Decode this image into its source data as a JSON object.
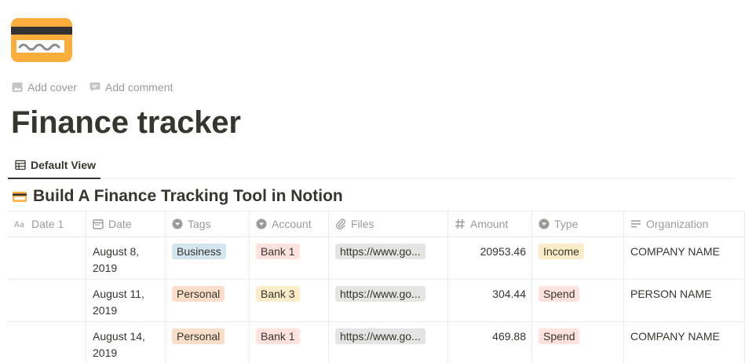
{
  "page": {
    "icon": "credit-card-icon",
    "actions": {
      "add_cover": "Add cover",
      "add_comment": "Add comment"
    },
    "title": "Finance tracker"
  },
  "views": [
    {
      "label": "Default View",
      "icon": "table-icon",
      "active": true
    }
  ],
  "database": {
    "icon": "credit-card-icon",
    "title": "Build A Finance Tracking Tool in Notion",
    "columns": [
      {
        "label": "Date 1",
        "icon": "title-aa-icon"
      },
      {
        "label": "Date",
        "icon": "calendar-icon"
      },
      {
        "label": "Tags",
        "icon": "select-icon"
      },
      {
        "label": "Account",
        "icon": "select-icon"
      },
      {
        "label": "Files",
        "icon": "paperclip-icon"
      },
      {
        "label": "Amount",
        "icon": "number-hash-icon"
      },
      {
        "label": "Type",
        "icon": "select-icon"
      },
      {
        "label": "Organization",
        "icon": "text-lines-icon"
      }
    ],
    "rows": [
      {
        "date1": "",
        "date": "August 8, 2019",
        "tag": "Business",
        "account": "Bank 1",
        "file": "https://www.go...",
        "amount": "20953.46",
        "type": "Income",
        "organization": "COMPANY NAME"
      },
      {
        "date1": "",
        "date": "August 11, 2019",
        "tag": "Personal",
        "account": "Bank 3",
        "file": "https://www.go...",
        "amount": "304.44",
        "type": "Spend",
        "organization": "PERSON NAME"
      },
      {
        "date1": "",
        "date": "August 14, 2019",
        "tag": "Personal",
        "account": "Bank 1",
        "file": "https://www.go...",
        "amount": "469.88",
        "type": "Spend",
        "organization": "COMPANY NAME"
      }
    ],
    "tag_colors": {
      "Business": "#d3e5ef",
      "Personal": "#fadec9",
      "Bank 1": "#ffe2dd",
      "Bank 3": "#fdecc8",
      "Income": "#fdecc8",
      "Spend": "#ffe2dd"
    }
  },
  "colors": {
    "text": "#37352f",
    "muted": "#9b9a97",
    "border": "#e9e9e7",
    "icon_orange": "#fbae3b"
  }
}
